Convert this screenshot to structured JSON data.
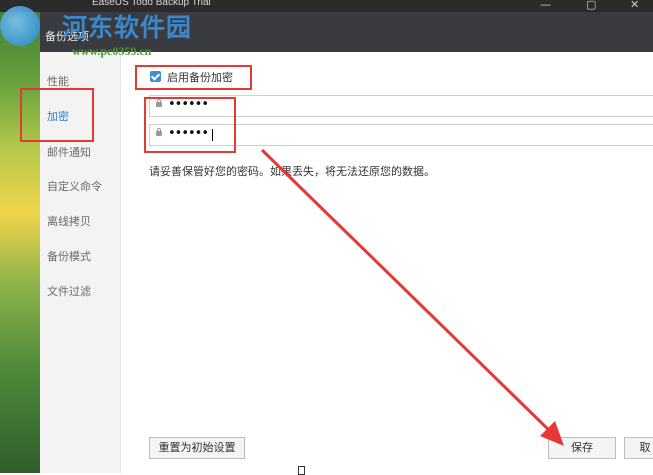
{
  "window": {
    "title": "EaseUS Todo Backup Trial",
    "minimize_glyph": "—",
    "restore_glyph": "▢",
    "close_glyph": "✕"
  },
  "dialog": {
    "title": "备份选项"
  },
  "sidebar": {
    "items": [
      {
        "label": "性能"
      },
      {
        "label": "加密"
      },
      {
        "label": "邮件通知"
      },
      {
        "label": "自定义命令"
      },
      {
        "label": "离线拷贝"
      },
      {
        "label": "备份模式"
      },
      {
        "label": "文件过滤"
      }
    ]
  },
  "encryption": {
    "enable_label": "启用备份加密",
    "enabled": true,
    "password": "••••••",
    "confirm_password": "••••••",
    "hint": "请妥善保管好您的密码。如果丢失，将无法还原您的数据。"
  },
  "buttons": {
    "reset_label": "重置为初始设置",
    "save_label": "保存",
    "cancel_label": "取"
  },
  "watermark": {
    "site_name": "河东软件园",
    "url": "www.pc0359.cn"
  },
  "colors": {
    "accent": "#2d7fc1",
    "annotation": "#e53935",
    "header": "#3a3b40"
  },
  "icons": [
    "lock-icon",
    "checkbox-checked-icon",
    "app-logo-icon"
  ]
}
